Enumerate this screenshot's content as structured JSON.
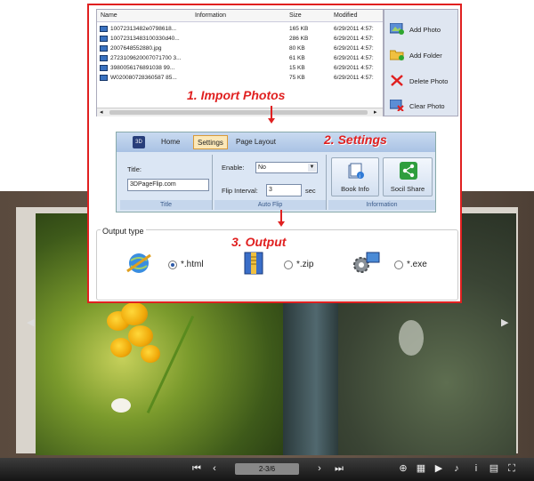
{
  "files": {
    "headers": [
      "Name",
      "Information",
      "Size",
      "Modified"
    ],
    "rows": [
      {
        "name": "10072313482e0798618...",
        "size": "165 KB",
        "modified": "6/29/2011 4:57:"
      },
      {
        "name": "10072313483100330d40...",
        "size": "286 KB",
        "modified": "6/29/2011 4:57:"
      },
      {
        "name": "2007648552880.jpg",
        "size": "80 KB",
        "modified": "6/29/2011 4:57:"
      },
      {
        "name": "2723109620007071700 3...",
        "size": "61 KB",
        "modified": "6/29/2011 4:57:"
      },
      {
        "name": "3980056176891038 99...",
        "size": "15 KB",
        "modified": "6/29/2011 4:57:"
      },
      {
        "name": "W020080728360587 85...",
        "size": "75 KB",
        "modified": "6/29/2011 4:57:"
      }
    ]
  },
  "actions": {
    "add_photo": "Add Photo",
    "add_folder": "Add Folder",
    "delete_photo": "Delete Photo",
    "clear_photo": "Clear Photo"
  },
  "steps": {
    "import": "1. Import Photos",
    "settings": "2. Settings",
    "output": "3. Output"
  },
  "ribbon": {
    "logo": "3D",
    "tabs": [
      "Home",
      "Settings",
      "Page Layout"
    ],
    "title_label": "Title:",
    "title_value": "3DPageFlip.com",
    "title_group": "Title",
    "enable_label": "Enable:",
    "enable_value": "No",
    "flip_label": "Flip Interval:",
    "flip_value": "3",
    "flip_unit": "sec",
    "autoflip_group": "Auto Flip",
    "book_info": "Book Info",
    "social_share": "Socil Share",
    "info_group": "Information"
  },
  "output": {
    "title": "Output type",
    "html": "*.html",
    "zip": "*.zip",
    "exe": "*.exe",
    "selected": "*.html"
  },
  "viewer": {
    "page_indicator": "2-3/6"
  },
  "colors": {
    "accent": "#e02020",
    "ribbon": "#dbe6f4"
  }
}
